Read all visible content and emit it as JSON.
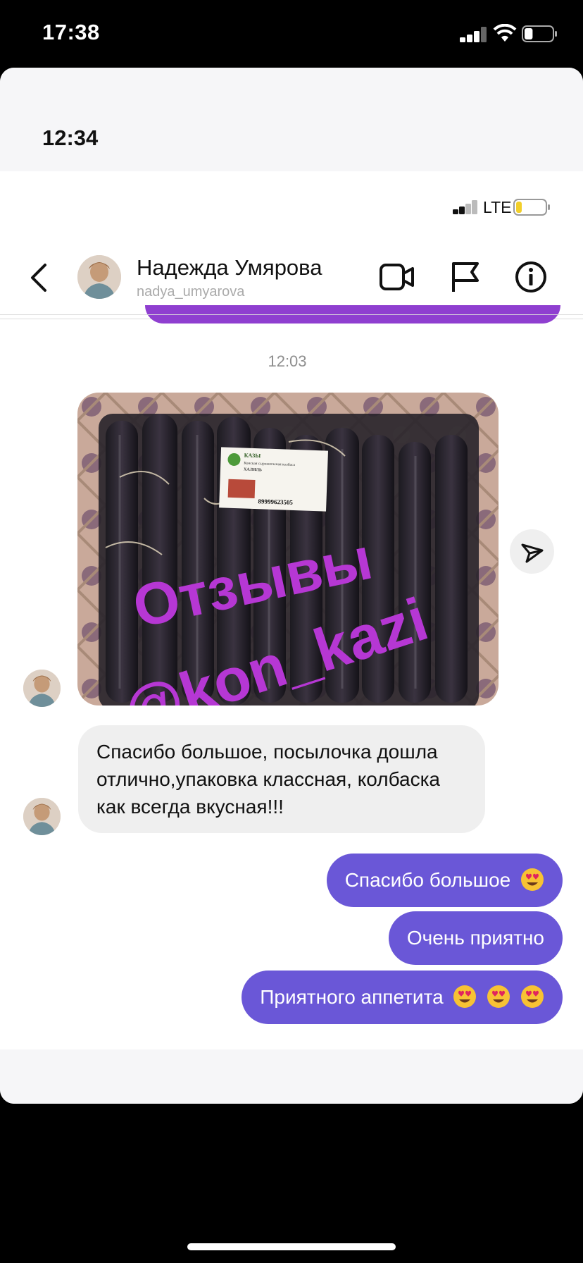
{
  "outer_status": {
    "time": "17:38",
    "battery_level": 0.3
  },
  "inner_status": {
    "time": "12:34",
    "network": "LTE",
    "battery_level": 0.2
  },
  "header": {
    "contact_name": "Надежда Умярова",
    "username": "nadya_umyarova"
  },
  "chat": {
    "timestamp": "12:03",
    "photo": {
      "overlay_line1": "Отзывы",
      "overlay_line2": "@kon_kazi",
      "label_title": "КАЗЫ",
      "label_subtitle": "Конская сырокопченая колбаса",
      "label_halal": "ХАЛЯЛЬ",
      "label_phone": "89999623505"
    },
    "incoming_message": "Спасибо большое, посылочка дошла отлично,упаковка классная, колбаска как всегда вкусная!!!",
    "outgoing_messages": [
      {
        "text": "Спасибо большое",
        "emoji_count": 1
      },
      {
        "text": "Очень приятно",
        "emoji_count": 0
      },
      {
        "text": "Приятного аппетита",
        "emoji_count": 3
      }
    ]
  },
  "icons": [
    "back-icon",
    "video-call-icon",
    "flag-icon",
    "info-icon",
    "share-icon",
    "heart-eyes-emoji"
  ],
  "colors": {
    "outgoing_bubble": "#6a57d7",
    "incoming_bubble": "#efefef",
    "overlay_text": "#b637d4"
  }
}
